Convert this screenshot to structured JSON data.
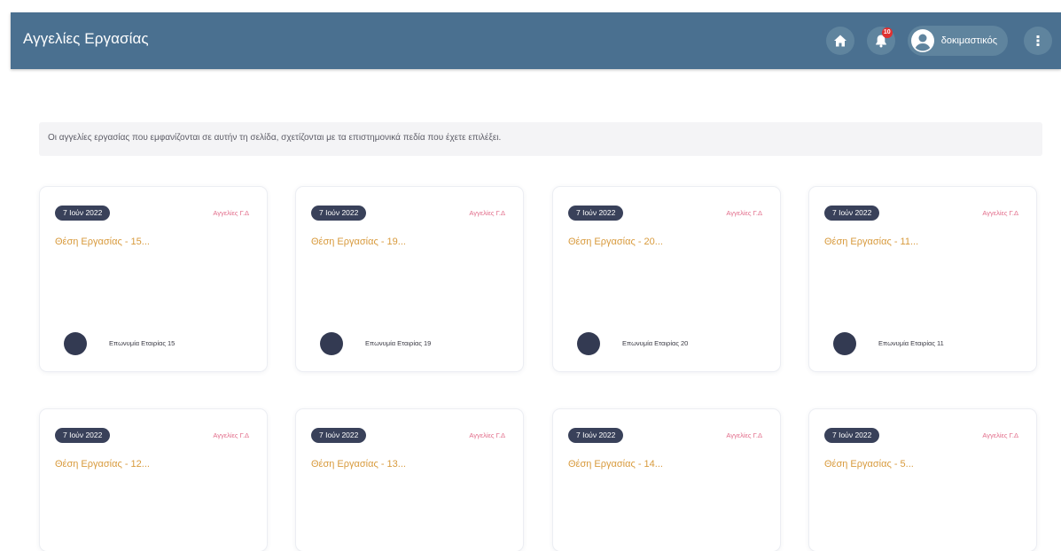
{
  "app": {
    "title": "Αγγελίες Εργασίας"
  },
  "header": {
    "notification_count": "10",
    "user_name": "δοκιμαστικός",
    "icons": {
      "home": "home-icon",
      "bell": "bell-icon",
      "user": "user-circle-icon",
      "more": "vertical-dots-icon"
    }
  },
  "info": {
    "text": "Οι αγγελίες εργασίας που εμφανίζονται σε αυτήν τη σελίδα, σχετίζονται με τα επιστημονικά πεδία που έχετε επιλέξει."
  },
  "colors": {
    "header": "#4a7090",
    "pill": "#39415a",
    "category": "#e26c8a",
    "job_title": "#d89a3c"
  },
  "jobs": [
    {
      "date": "7 Ιούν 2022",
      "category": "Αγγελίες Γ.Δ",
      "title": "Θέση Εργασίας - 15...",
      "company": "Επωνυμία Εταιρίας 15"
    },
    {
      "date": "7 Ιούν 2022",
      "category": "Αγγελίες Γ.Δ",
      "title": "Θέση Εργασίας - 19...",
      "company": "Επωνυμία Εταιρίας 19"
    },
    {
      "date": "7 Ιούν 2022",
      "category": "Αγγελίες Γ.Δ",
      "title": "Θέση Εργασίας - 20...",
      "company": "Επωνυμία Εταιρίας 20"
    },
    {
      "date": "7 Ιούν 2022",
      "category": "Αγγελίες Γ.Δ",
      "title": "Θέση Εργασίας - 11...",
      "company": "Επωνυμία Εταιρίας 11"
    },
    {
      "date": "7 Ιούν 2022",
      "category": "Αγγελίες Γ.Δ",
      "title": "Θέση Εργασίας - 12...",
      "company": ""
    },
    {
      "date": "7 Ιούν 2022",
      "category": "Αγγελίες Γ.Δ",
      "title": "Θέση Εργασίας - 13...",
      "company": ""
    },
    {
      "date": "7 Ιούν 2022",
      "category": "Αγγελίες Γ.Δ",
      "title": "Θέση Εργασίας - 14...",
      "company": ""
    },
    {
      "date": "7 Ιούν 2022",
      "category": "Αγγελίες Γ.Δ",
      "title": "Θέση Εργασίας - 5...",
      "company": ""
    }
  ]
}
